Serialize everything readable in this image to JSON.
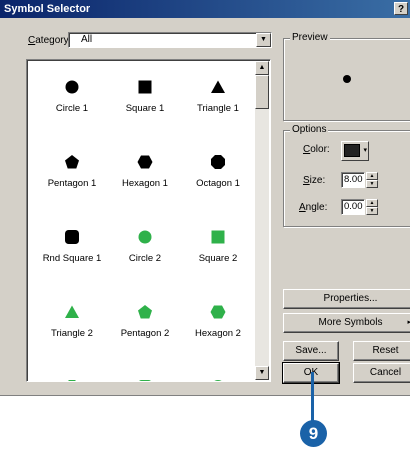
{
  "window": {
    "title": "Symbol Selector",
    "help_glyph": "?"
  },
  "category": {
    "label": "Category:",
    "value": "All"
  },
  "gallery": {
    "symbols": [
      {
        "name": "Circle 1",
        "shape": "circle",
        "color": "#000000"
      },
      {
        "name": "Square 1",
        "shape": "square",
        "color": "#000000"
      },
      {
        "name": "Triangle 1",
        "shape": "triangle",
        "color": "#000000"
      },
      {
        "name": "Pentagon 1",
        "shape": "pentagon",
        "color": "#000000"
      },
      {
        "name": "Hexagon 1",
        "shape": "hexagon",
        "color": "#000000"
      },
      {
        "name": "Octagon 1",
        "shape": "octagon",
        "color": "#000000"
      },
      {
        "name": "Rnd Square 1",
        "shape": "rounded-square",
        "color": "#000000"
      },
      {
        "name": "Circle 2",
        "shape": "circle",
        "color": "#2fb14a"
      },
      {
        "name": "Square 2",
        "shape": "square",
        "color": "#2fb14a"
      },
      {
        "name": "Triangle 2",
        "shape": "triangle",
        "color": "#2fb14a"
      },
      {
        "name": "Pentagon 2",
        "shape": "pentagon",
        "color": "#2fb14a"
      },
      {
        "name": "Hexagon 2",
        "shape": "hexagon",
        "color": "#2fb14a"
      },
      {
        "name": "",
        "shape": "octagon",
        "color": "#2fb14a"
      },
      {
        "name": "",
        "shape": "rounded-square",
        "color": "#2fb14a"
      },
      {
        "name": "",
        "shape": "circle-dot",
        "color": "#2fb14a"
      }
    ]
  },
  "preview": {
    "label": "Preview"
  },
  "options": {
    "label": "Options",
    "color_label": "Color:",
    "color_value": "#222222",
    "size_label": "Size:",
    "size_value": "8.00",
    "angle_label": "Angle:",
    "angle_value": "0.00"
  },
  "buttons": {
    "properties": "Properties...",
    "more_symbols": "More Symbols",
    "save": "Save...",
    "reset": "Reset",
    "ok": "OK",
    "cancel": "Cancel"
  },
  "callout": {
    "step": "9"
  }
}
